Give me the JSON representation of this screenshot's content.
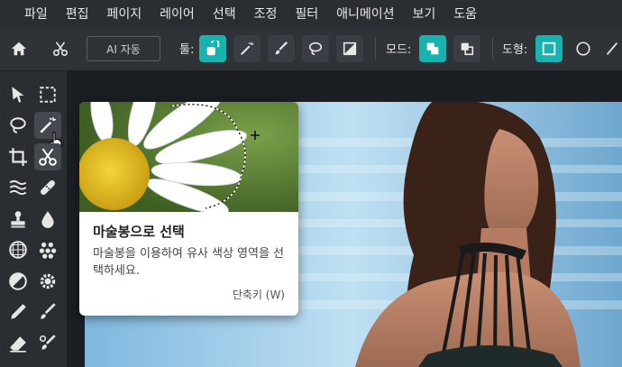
{
  "menu": [
    "파일",
    "편집",
    "페이지",
    "레이어",
    "선택",
    "조정",
    "필터",
    "애니메이션",
    "보기",
    "도움"
  ],
  "toolbar": {
    "ai_button": "AI 자동",
    "tool_label": "툴:",
    "mode_label": "모드:",
    "shape_label": "도형:"
  },
  "tooltip": {
    "title": "마술봉으로 선택",
    "description": "마술봉을 이용하여 유사 색상 영역을 선택하세요.",
    "shortcut": "단축키 (W)"
  },
  "colors": {
    "accent": "#16b3b0",
    "menubar": "#2a2d32",
    "toolbar": "#2f3237",
    "background": "#1b1e23"
  }
}
